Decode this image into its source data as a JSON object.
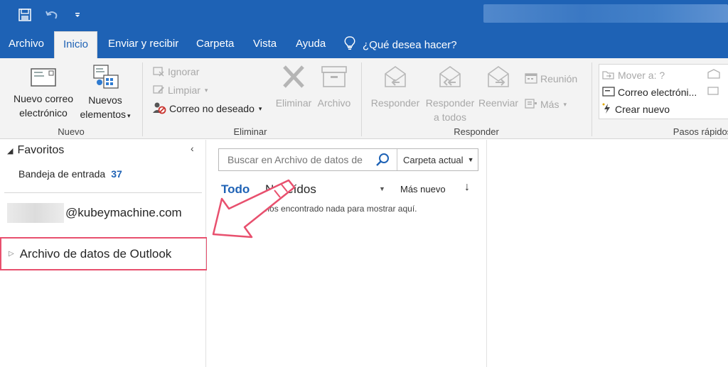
{
  "qat": {
    "save_icon": "save-icon",
    "undo_icon": "undo-icon",
    "customize_icon": "customize-qat-icon"
  },
  "tabs": [
    {
      "label": "Archivo"
    },
    {
      "label": "Inicio",
      "active": true
    },
    {
      "label": "Enviar y recibir"
    },
    {
      "label": "Carpeta"
    },
    {
      "label": "Vista"
    },
    {
      "label": "Ayuda"
    }
  ],
  "tellme": {
    "label": "¿Qué desea hacer?",
    "icon": "lightbulb-icon"
  },
  "ribbon": {
    "nuevo": {
      "group_label": "Nuevo",
      "new_email_line1": "Nuevo correo",
      "new_email_line2": "electrónico",
      "new_items_line1": "Nuevos",
      "new_items_line2": "elementos"
    },
    "eliminar": {
      "group_label": "Eliminar",
      "ignore": "Ignorar",
      "cleanup": "Limpiar",
      "junk": "Correo no deseado",
      "delete": "Eliminar",
      "archive": "Archivo"
    },
    "responder": {
      "group_label": "Responder",
      "reply": "Responder",
      "reply_all_line1": "Responder",
      "reply_all_line2": "a todos",
      "forward": "Reenviar",
      "meeting": "Reunión",
      "more": "Más"
    },
    "pasos": {
      "group_label": "Pasos rápidos",
      "move_to": "Mover a: ?",
      "email": "Correo electróni...",
      "create_new": "Crear nuevo"
    }
  },
  "folders": {
    "favorites_label": "Favoritos",
    "inbox_label": "Bandeja de entrada",
    "inbox_count": "37",
    "account_suffix": "@kubeymachine.com",
    "datafile_label": "Archivo de datos de Outlook"
  },
  "messages": {
    "search_placeholder": "Buscar en Archivo de datos de",
    "scope": "Carpeta actual",
    "filter_all": "Todo",
    "filter_unread": "No leídos",
    "sort_label": "Más nuevo",
    "empty_text": "No hemos encontrado nada para mostrar aquí."
  },
  "colors": {
    "brand_blue": "#1e62b5",
    "highlight_pink": "#e8506e",
    "ribbon_bg": "#f3f3f3"
  }
}
